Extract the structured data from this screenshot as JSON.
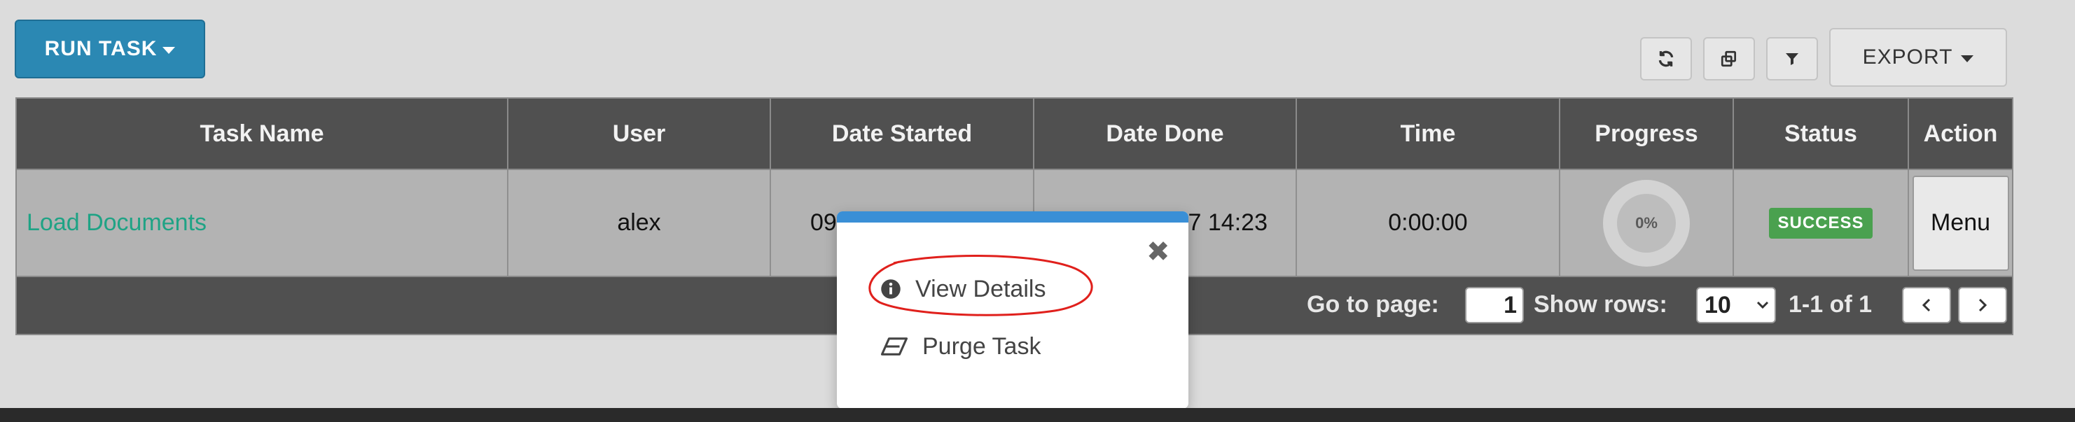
{
  "toolbar": {
    "run_task_label": "RUN TASK",
    "refresh_icon": "refresh-icon",
    "copy_icon": "copy-icon",
    "filter_icon": "filter-icon",
    "export_label": "EXPORT"
  },
  "table": {
    "columns": [
      "Task Name",
      "User",
      "Date Started",
      "Date Done",
      "Time",
      "Progress",
      "Status",
      "Action"
    ],
    "row": {
      "task_name": "Load Documents",
      "user": "alex",
      "date_started": "09-",
      "date_done": "7 14:23",
      "time": "0:00:00",
      "progress": "0%",
      "progress_value": 0,
      "status": "SUCCESS",
      "action_label": "Menu"
    }
  },
  "pagination": {
    "go_to_label": "Go to page:",
    "page": "1",
    "show_rows_label": "Show rows:",
    "rows_value": "10",
    "range_text": "1-1 of 1"
  },
  "popup": {
    "close_icon": "close-icon",
    "items": [
      {
        "label": "View Details",
        "icon": "info-circle-icon"
      },
      {
        "label": "Purge Task",
        "icon": "eraser-icon"
      }
    ]
  },
  "colors": {
    "primary": "#2b88b3",
    "link": "#1fa385",
    "success": "#4aa14f",
    "popup_accent": "#3a8fd6",
    "annotation": "#e0201c"
  }
}
